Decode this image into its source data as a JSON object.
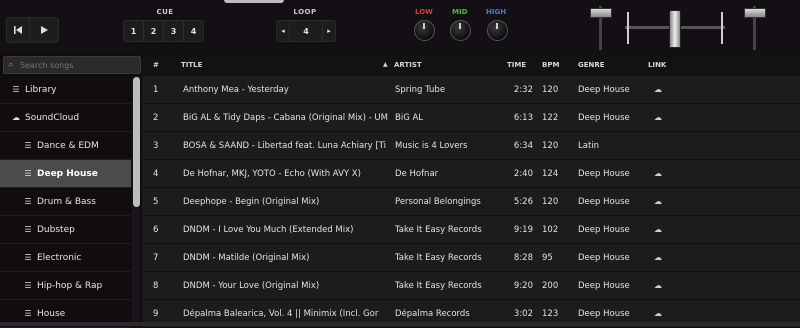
{
  "deck": {
    "cue_label": "CUE",
    "cue_buttons": [
      "1",
      "2",
      "3",
      "4"
    ],
    "loop_label": "LOOP",
    "loop_prev": "◂",
    "loop_value": "4",
    "loop_next": "▸",
    "eq": {
      "low_label": "LOW",
      "low_color": "#d93a3a",
      "mid_label": "MID",
      "mid_color": "#3fbf3f",
      "high_label": "HIGH",
      "high_color": "#3f7fd9"
    }
  },
  "search": {
    "placeholder": "Search songs",
    "value": ""
  },
  "sidebar": {
    "items": [
      {
        "label": "Library",
        "icon": "playlist-icon"
      },
      {
        "label": "SoundCloud",
        "icon": "soundcloud-icon"
      },
      {
        "label": "Dance & EDM",
        "icon": "playlist-icon"
      },
      {
        "label": "Deep House",
        "icon": "playlist-icon",
        "active": true
      },
      {
        "label": "Drum & Bass",
        "icon": "playlist-icon"
      },
      {
        "label": "Dubstep",
        "icon": "playlist-icon"
      },
      {
        "label": "Electronic",
        "icon": "playlist-icon"
      },
      {
        "label": "Hip-hop & Rap",
        "icon": "playlist-icon"
      },
      {
        "label": "House",
        "icon": "playlist-icon"
      }
    ]
  },
  "table": {
    "columns": {
      "num": "#",
      "title": "TITLE",
      "artist": "ARTIST",
      "time": "TIME",
      "bpm": "BPM",
      "genre": "GENRE",
      "link": "LINK"
    },
    "sort_indicator": "▲",
    "rows": [
      {
        "num": "1",
        "title": "Anthony Mea - Yesterday",
        "artist": "Spring Tube",
        "time": "2:32",
        "bpm": "120",
        "genre": "Deep House"
      },
      {
        "num": "2",
        "title": "BiG AL & Tidy Daps - Cabana (Original Mix) - UM",
        "artist": "BiG AL",
        "time": "6:13",
        "bpm": "122",
        "genre": "Deep House"
      },
      {
        "num": "3",
        "title": "BÓSA & SAAND - Libertad feat. Luna Achiary [Ti",
        "artist": "Music is 4 Lovers",
        "time": "6:34",
        "bpm": "120",
        "genre": "Latin"
      },
      {
        "num": "4",
        "title": "De Hofnar, MKJ, YOTO - Echo (With AVY X)",
        "artist": "De Hofnar",
        "time": "2:40",
        "bpm": "124",
        "genre": "Deep House"
      },
      {
        "num": "5",
        "title": "Deephope - Begin (Original Mix)",
        "artist": "Personal Belongings",
        "time": "5:26",
        "bpm": "120",
        "genre": "Deep House"
      },
      {
        "num": "6",
        "title": "DNDM - I Love You Much (Extended Mix)",
        "artist": "Take It Easy Records",
        "time": "9:19",
        "bpm": "102",
        "genre": "Deep House"
      },
      {
        "num": "7",
        "title": "DNDM - Matilde (Original Mix)",
        "artist": "Take It Easy Records",
        "time": "8:28",
        "bpm": "95",
        "genre": "Deep House"
      },
      {
        "num": "8",
        "title": "DNDM - Your Love (Original Mix)",
        "artist": "Take It Easy Records",
        "time": "9:20",
        "bpm": "200",
        "genre": "Deep House"
      },
      {
        "num": "9",
        "title": "Dépalma Balearica, Vol. 4 || Minimix (Incl. Gor",
        "artist": "Dépalma Records",
        "time": "3:02",
        "bpm": "123",
        "genre": "Deep House"
      }
    ],
    "link_icon": "☁"
  }
}
